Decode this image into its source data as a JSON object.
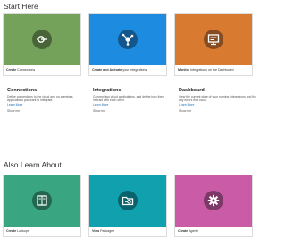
{
  "sections": {
    "start_here": "Start Here",
    "also_learn": "Also Learn About"
  },
  "cards": [
    {
      "bold": "Create",
      "rest": " Connections",
      "color": "#74a25b",
      "icon": "plug-icon"
    },
    {
      "bold": "Create and Activate",
      "rest": " your Integrations",
      "color": "#1d8be0",
      "icon": "integration-icon"
    },
    {
      "bold": "Monitor",
      "rest": " Integrations on the Dashboard",
      "color": "#d97a31",
      "icon": "dashboard-icon"
    },
    {
      "bold": "Create",
      "rest": " Lookups",
      "color": "#3aa581",
      "icon": "lookup-icon"
    },
    {
      "bold": "View",
      "rest": " Packages",
      "color": "#10a0ae",
      "icon": "package-icon"
    },
    {
      "bold": "Create",
      "rest": " Agents",
      "color": "#c95ba7",
      "icon": "gear-icon"
    }
  ],
  "info": [
    {
      "title": "Connections",
      "desc": "Define connections to the cloud and on-premises applications you want to integrate.",
      "link": "Learn More",
      "show": "Show me"
    },
    {
      "title": "Integrations",
      "desc": "Connect two cloud applications, and define how they interact with each other.",
      "link": "Learn More",
      "show": "Show me"
    },
    {
      "title": "Dashboard",
      "desc": "View the current state of your running integrations and fix any errors that occur.",
      "link": "Learn More",
      "show": "Show me"
    }
  ]
}
